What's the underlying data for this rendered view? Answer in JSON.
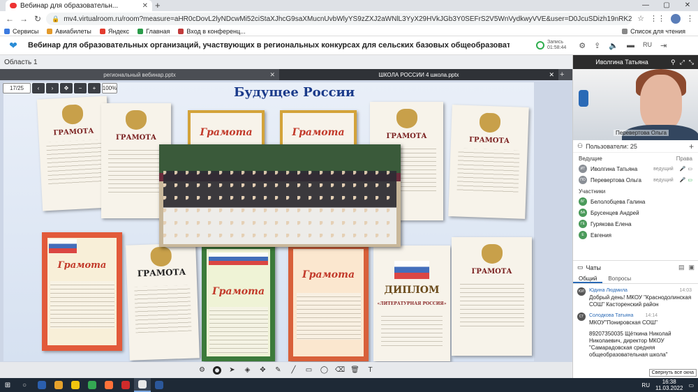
{
  "browser": {
    "tab_title": "Вебинар для образовательн...",
    "url": "mv4.virtualroom.ru/room?measure=aHR0cDovL2lyNDcwMi52ciStaXJhcG9saXMucnUvbWlyYS9zZXJ2aWNlL3YyX29HVkJGb3Y0SEFrS2V5WnVydkwyVVE&user=D0JcuSDizh19nRK2wXzYGg",
    "bookmarks": [
      {
        "label": "Сервисы",
        "color": "#3c7be0"
      },
      {
        "label": "Авиабилеты",
        "color": "#e39a2b"
      },
      {
        "label": "Яндекс",
        "color": "#e33b2e"
      },
      {
        "label": "Главная",
        "color": "#2b9c4a"
      },
      {
        "label": "Вход в конференц...",
        "color": "#c23b3b"
      }
    ],
    "reading_list": "Список для чтения"
  },
  "app": {
    "webinar_title": "Вебинар для образовательных организаций, участвующих в региональных конкурсах для сельских базовых общеобразовательных организаций, реализующих инновационные образовательные прог...",
    "rec_label": "Запись",
    "rec_time": "01:58:44",
    "lang": "RU"
  },
  "workspace": {
    "area_label": "Область 1",
    "tabs": [
      {
        "label": "региональный вебинар.pptx",
        "active": false
      },
      {
        "label": "ШКОЛА РОССИИ 4 школа.pptx",
        "active": true
      }
    ],
    "page_field": "17/25",
    "zoom": "100%",
    "slide_title": "Будущее России",
    "cert_labels": {
      "gramota": "ГРАМОТА",
      "gramota_script": "Грамота",
      "diploma": "ДИПЛОМ",
      "literature": "«ЛИТЕРАТУРНАЯ РОССИЯ»"
    }
  },
  "panel": {
    "speaker_name": "Иволгина Татьяна",
    "video_name": "Перевертова Ольга",
    "users_label": "Пользователи",
    "users_count": "25",
    "leaders_label": "Ведущие",
    "rights_label": "Права",
    "leaders": [
      {
        "initials": "ИТ",
        "name": "Иволгина Татьяна",
        "role": "ведущий"
      },
      {
        "initials": "ПО",
        "name": "Перевертова Ольга",
        "role": "ведущий"
      }
    ],
    "participants_label": "Участники",
    "participants": [
      {
        "initials": "БГ",
        "name": "Белолобцева Галина"
      },
      {
        "initials": "БА",
        "name": "Брусенцев Андрей"
      },
      {
        "initials": "ГЕ",
        "name": "Гурякова Елена"
      },
      {
        "initials": "Е",
        "name": "Евгения"
      }
    ],
    "chats_label": "Чаты",
    "chat_tabs": [
      "Общий",
      "Вопросы"
    ],
    "messages": [
      {
        "initials": "ЮЛ",
        "author": "Юдина Людмила",
        "time": "14:03",
        "text": "Добрый день! МКОУ \"Краснодолинская СОШ\" Касторенский район"
      },
      {
        "initials": "СТ",
        "author": "Солодкова Татьяна",
        "time": "14:14",
        "text": "МКОУ\"Понировская СОШ\""
      },
      {
        "initials": "",
        "author": "",
        "time": "",
        "text": "89207350035 Щёткина Николай Николаевич, директор МКОУ \"Самарадовская средняя общеобразовательная школа\""
      }
    ],
    "tooltip": "Свернуть все окна"
  },
  "taskbar": {
    "lang": "RU",
    "time": "16:38",
    "date": "11.03.2022",
    "apps": [
      "#2b5fae",
      "#e6a22b",
      "#f1c40f",
      "#34a853",
      "#ff7139",
      "#d12b2b",
      "#e8e8e8",
      "#2b579a"
    ]
  }
}
